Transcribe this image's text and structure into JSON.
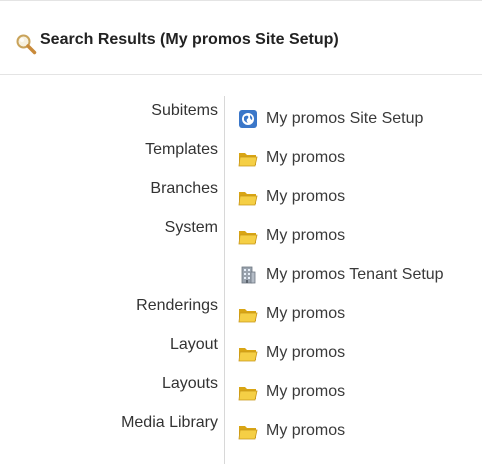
{
  "header": {
    "title": "Search Results (My promos Site Setup)",
    "icon": "search-icon"
  },
  "colors": {
    "text": "#333333",
    "divider": "#d8d8d8",
    "folder_yellow": "#f2c532",
    "site_blue": "#3b77c9"
  },
  "results": [
    {
      "label": "Subitems",
      "item": "My promos Site Setup",
      "icon": "site-globe-icon"
    },
    {
      "label": "Templates",
      "item": "My promos",
      "icon": "folder-icon"
    },
    {
      "label": "Branches",
      "item": "My promos",
      "icon": "folder-icon"
    },
    {
      "label": "System",
      "item": "My promos",
      "icon": "folder-icon"
    },
    {
      "label": "",
      "item": "My promos Tenant Setup",
      "icon": "building-icon"
    },
    {
      "label": "Renderings",
      "item": "My promos",
      "icon": "folder-icon"
    },
    {
      "label": "Layout",
      "item": "My promos",
      "icon": "folder-icon"
    },
    {
      "label": "Layouts",
      "item": "My promos",
      "icon": "folder-icon"
    },
    {
      "label": "Media Library",
      "item": "My promos",
      "icon": "folder-icon"
    }
  ]
}
